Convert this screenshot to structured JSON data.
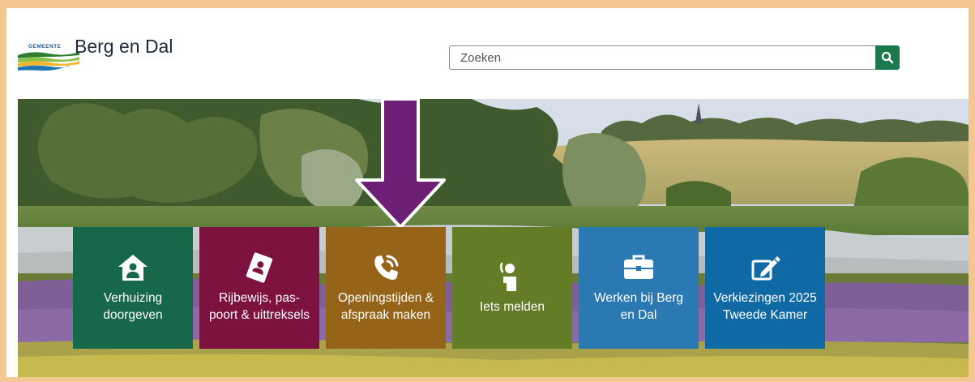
{
  "header": {
    "logo": {
      "small_text": "GEMEENTE",
      "name": "Berg en Dal"
    },
    "search": {
      "placeholder": "Zoeken",
      "button_icon": "search-icon"
    }
  },
  "tiles": [
    {
      "label": "Verhuizing doorgeven",
      "icon": "house-person-icon",
      "color": "#17684a"
    },
    {
      "label": "Rijbewijs, pas-poort & uittreksels",
      "icon": "id-book-icon",
      "color": "#7d1240"
    },
    {
      "label": "Openingstijden & afspraak maken",
      "icon": "phone-icon",
      "color": "#956418"
    },
    {
      "label": "Iets melden",
      "icon": "person-speech-icon",
      "color": "#637c26"
    },
    {
      "label": "Werken bij Berg en Dal",
      "icon": "briefcase-icon",
      "color": "#2a79b3"
    },
    {
      "label": "Verkiezingen 2025 Tweede Kamer",
      "icon": "pencil-square-icon",
      "color": "#0f69a4"
    }
  ],
  "annotation": {
    "arrow_color": "#6c1f74"
  },
  "colors": {
    "page_border": "#f4c690",
    "search_button": "#1a7a4c"
  }
}
